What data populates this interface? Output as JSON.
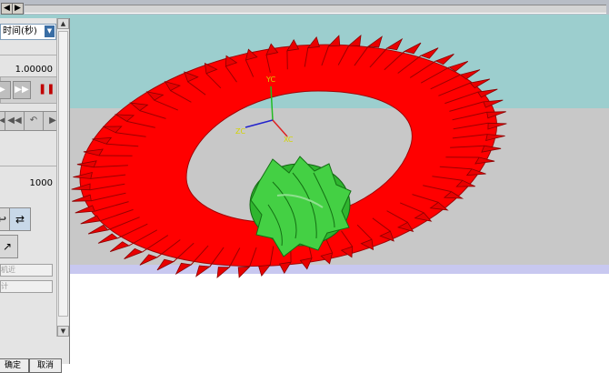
{
  "panel": {
    "time_unit_select": "时间(秒)",
    "speed_value": "1.00000",
    "steps_value": "1000",
    "field_1": "机近",
    "field_2": "计",
    "ok_label": "确定",
    "cancel_label": "取消"
  },
  "viewport": {
    "axis_y": "YC",
    "axis_z": "ZC",
    "axis_x": "XC"
  },
  "colors": {
    "gear_red": "#ff0000",
    "pinion_green": "#33c333",
    "sky": "#9ccece",
    "floor": "#c8c8c8"
  }
}
